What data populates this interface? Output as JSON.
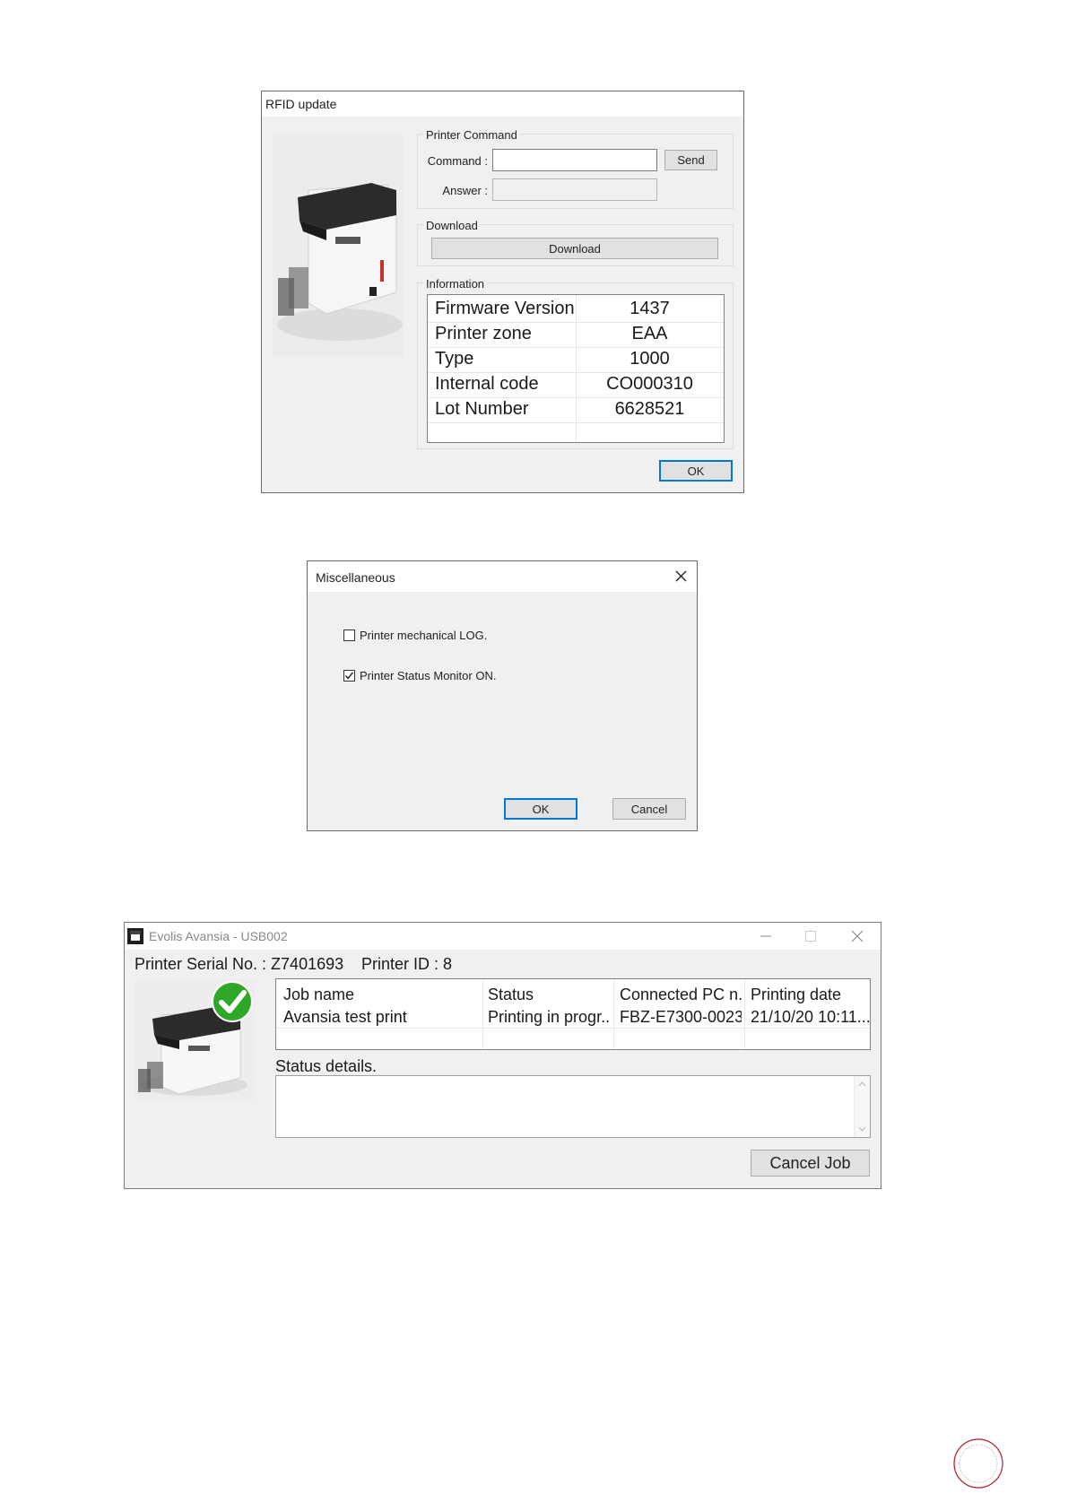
{
  "rfid_dialog": {
    "title": "RFID update",
    "printer_command": {
      "group_label": "Printer Command",
      "command_label": "Command :",
      "command_value": "",
      "answer_label": "Answer :",
      "answer_value": "",
      "send_label": "Send"
    },
    "download": {
      "group_label": "Download",
      "button_label": "Download"
    },
    "information": {
      "group_label": "Information",
      "rows": [
        {
          "key": "Firmware Version",
          "value": "1437"
        },
        {
          "key": "Printer zone",
          "value": "EAA"
        },
        {
          "key": "Type",
          "value": "1000"
        },
        {
          "key": "Internal code",
          "value": "CO000310"
        },
        {
          "key": "Lot Number",
          "value": "6628521"
        }
      ]
    },
    "ok_label": "OK"
  },
  "misc_dialog": {
    "title": "Miscellaneous",
    "close_icon": "close-icon",
    "options": [
      {
        "label": "Printer mechanical LOG.",
        "checked": false
      },
      {
        "label": "Printer Status Monitor ON.",
        "checked": true
      }
    ],
    "ok_label": "OK",
    "cancel_label": "Cancel"
  },
  "status_window": {
    "title": "Evolis Avansia - USB002",
    "serial_label": "Printer Serial No. : Z7401693",
    "printer_id_label": "Printer ID : 8",
    "status_icon": "checkmark-icon",
    "columns": [
      "Job name",
      "Status",
      "Connected PC n...",
      "Printing date"
    ],
    "rows": [
      [
        "Avansia test print",
        "Printing in progr...",
        "FBZ-E7300-0023",
        "21/10/20 10:11..."
      ]
    ],
    "status_details_label": "Status details.",
    "status_details_value": "",
    "cancel_job_label": "Cancel Job"
  },
  "colors": {
    "accent": "#0078d7",
    "window_bg": "#f0f0f0",
    "check_green": "#2fa82a"
  }
}
